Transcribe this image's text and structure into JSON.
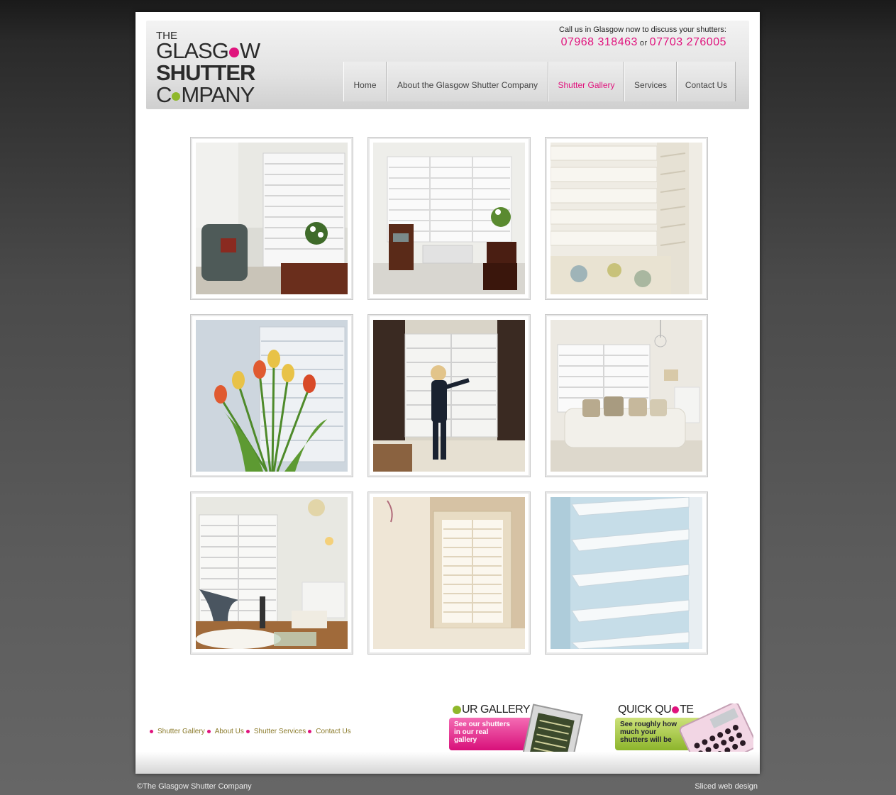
{
  "header": {
    "logo_the": "THE",
    "logo_line1_a": "GLASG",
    "logo_line1_b": "W",
    "logo_line2": "SHUTTER",
    "logo_line3_a": "C",
    "logo_line3_b": "MPANY",
    "call_text": "Call us in Glasgow now to discuss your shutters:",
    "phone1": "07968 318463",
    "or": "or",
    "phone2": "07703 276005"
  },
  "nav": [
    {
      "label": "Home"
    },
    {
      "label": "About the Glasgow Shutter Company"
    },
    {
      "label": "Shutter Gallery",
      "active": true
    },
    {
      "label": "Services"
    },
    {
      "label": "Contact Us"
    }
  ],
  "footer_links": [
    "Shutter Gallery",
    "About Us",
    "Shutter Services",
    "Contact Us"
  ],
  "promos": {
    "gallery": {
      "title_a": "",
      "title_b": "UR GALLERY",
      "text": "See our shutters in our real gallery"
    },
    "quote": {
      "title_a": "QUICK QU",
      "title_b": "TE",
      "text": "See roughly how much your shutters will be"
    }
  },
  "copyright": "©The Glasgow Shutter Company",
  "credit": "Sliced web design",
  "colors": {
    "accent_pink": "#e0137d",
    "accent_green": "#8fb82b",
    "footer_link": "#8a7a2a"
  },
  "gallery_images": [
    {
      "name": "living-room-armchair-photo"
    },
    {
      "name": "bay-window-chair-photo"
    },
    {
      "name": "shutter-closeup-bed-photo"
    },
    {
      "name": "tulips-window-photo"
    },
    {
      "name": "woman-opening-shutters-photo"
    },
    {
      "name": "sofa-living-room-photo"
    },
    {
      "name": "lounge-chandelier-photo"
    },
    {
      "name": "cream-room-window-photo"
    },
    {
      "name": "louvre-closeup-photo"
    }
  ]
}
